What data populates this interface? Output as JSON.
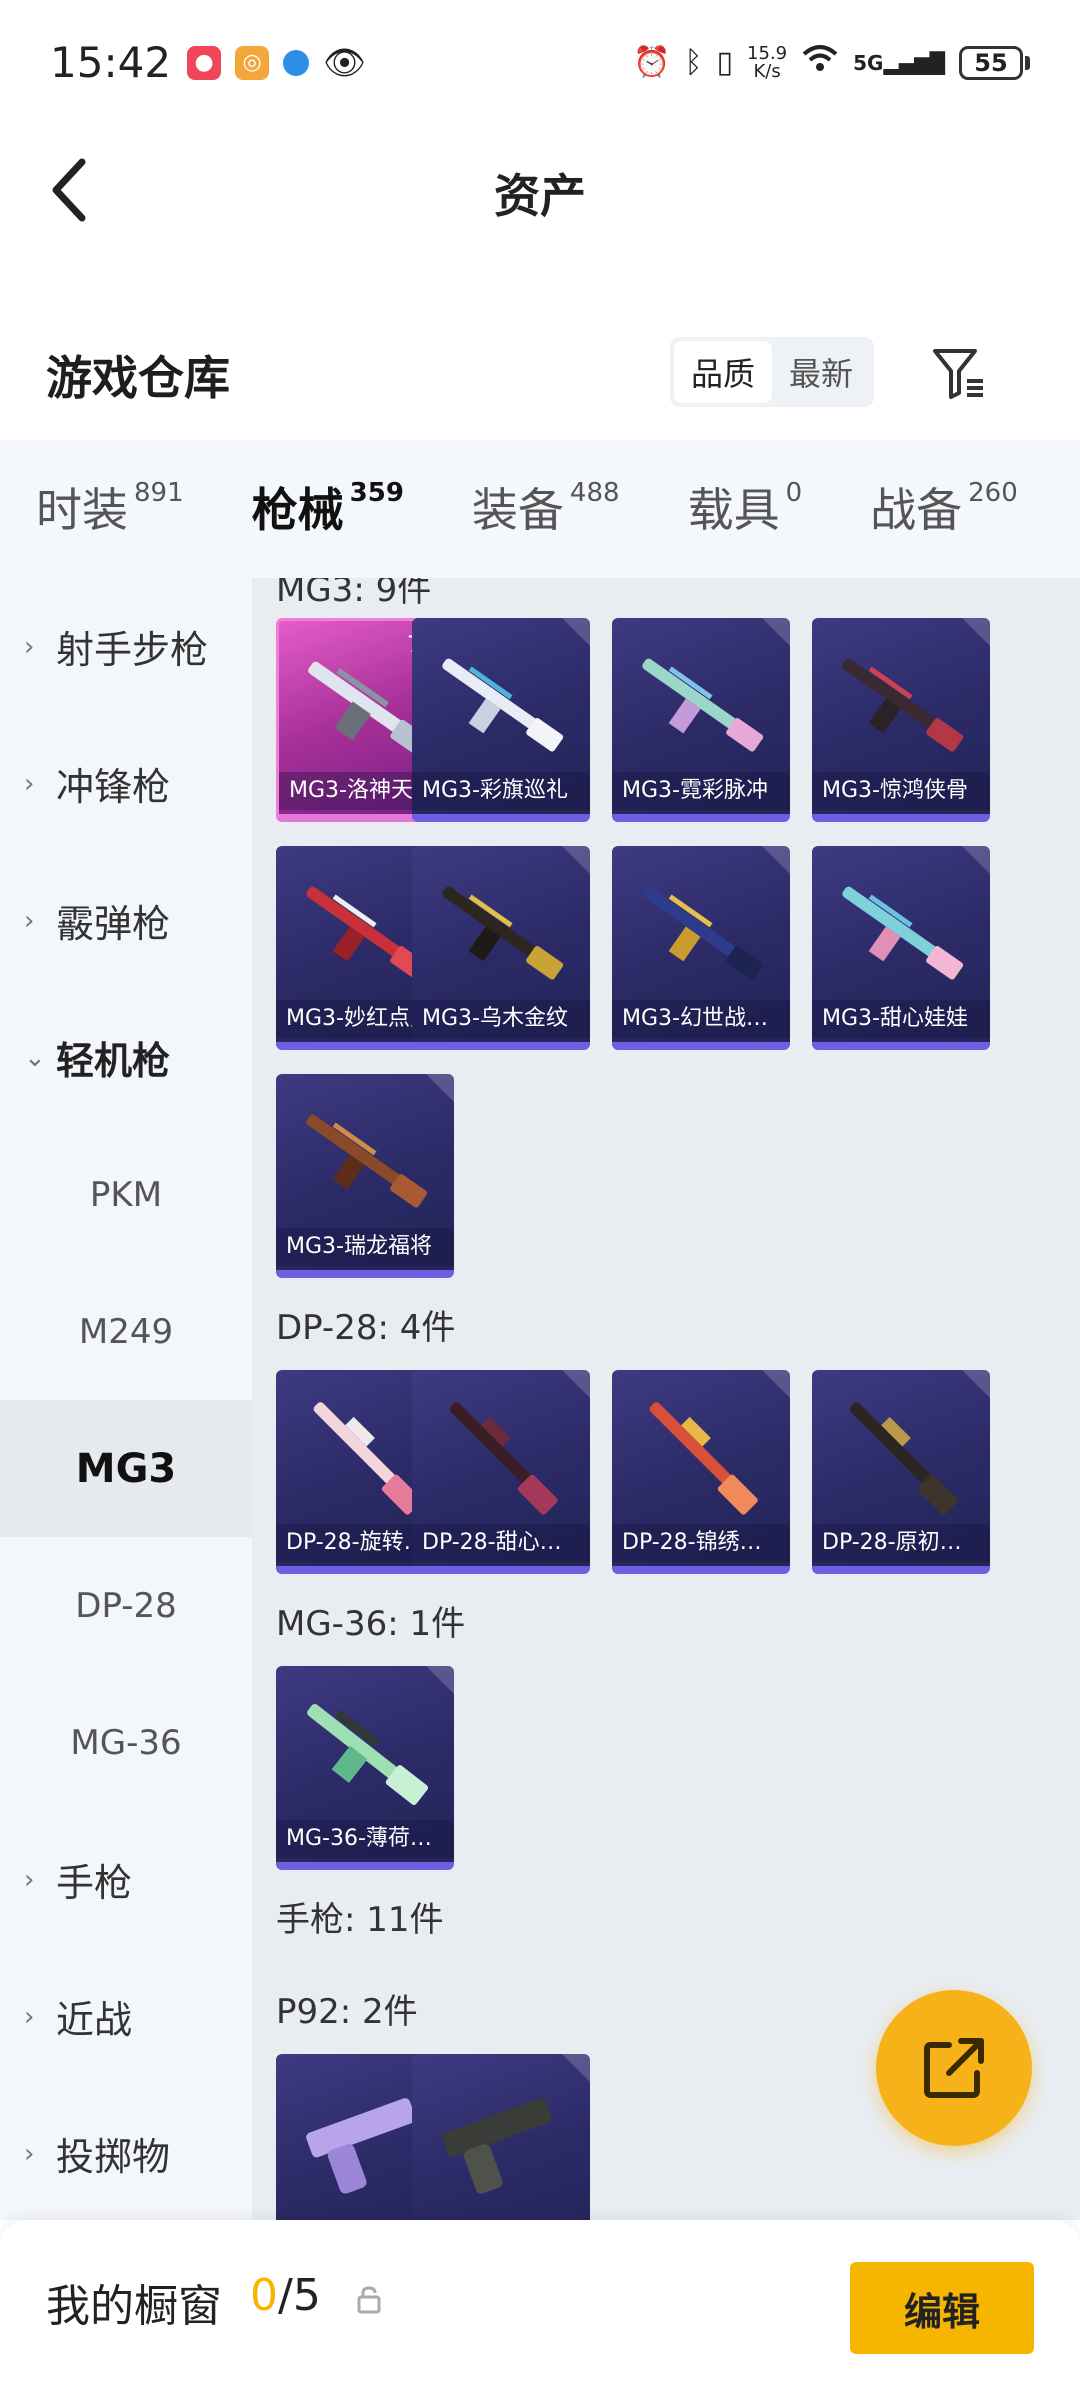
{
  "status_bar": {
    "time": "15:42",
    "speed_value": "15.9",
    "speed_unit": "K/s",
    "network": "5G",
    "battery": "55"
  },
  "header": {
    "title": "资产"
  },
  "section": {
    "title": "游戏仓库",
    "sort_options": [
      "品质",
      "最新"
    ],
    "active_sort": "品质"
  },
  "tabs": [
    {
      "label": "时装",
      "count": "891"
    },
    {
      "label": "枪械",
      "count": "359",
      "active": true
    },
    {
      "label": "装备",
      "count": "488"
    },
    {
      "label": "载具",
      "count": "0"
    },
    {
      "label": "战备",
      "count": "260"
    }
  ],
  "sidebar": {
    "items": [
      "射手步枪",
      "冲锋枪",
      "霰弹枪",
      "轻机枪",
      "手枪",
      "近战",
      "投掷物"
    ],
    "sub_items": [
      "PKM",
      "M249",
      "MG3",
      "DP-28",
      "MG-36"
    ],
    "active_sub": "MG3"
  },
  "content": {
    "partial_header": "MG3: 9件",
    "mg3_items": [
      "MG3-洛神天依",
      "MG3-彩旗巡礼",
      "MG3-霓彩脉冲",
      "MG3-惊鸿侠骨",
      "MG3-妙红点点",
      "MG3-乌木金纹",
      "MG3-幻世战…",
      "MG3-甜心娃娃",
      "MG3-瑞龙福将"
    ],
    "mg3_first_level": "7级",
    "dp28_header": "DP-28: 4件",
    "dp28_items": [
      "DP-28-旋转…",
      "DP-28-甜心…",
      "DP-28-锦绣…",
      "DP-28-原初…"
    ],
    "mg36_header": "MG-36: 1件",
    "mg36_items": [
      "MG-36-薄荷…"
    ],
    "pistol_header": "手枪: 11件",
    "p92_header": "P92: 2件"
  },
  "bottom_bar": {
    "label": "我的橱窗",
    "count_current": "0",
    "count_total": "/5",
    "edit_label": "编辑"
  },
  "colors": {
    "accent": "#f6b400",
    "card_bg": "#2b2a66",
    "card_highlight": "#e55cc8"
  },
  "icons": [
    "back-arrow-icon",
    "filter-icon",
    "share-icon",
    "lock-icon",
    "chevron-right-icon",
    "chevron-down-icon"
  ]
}
